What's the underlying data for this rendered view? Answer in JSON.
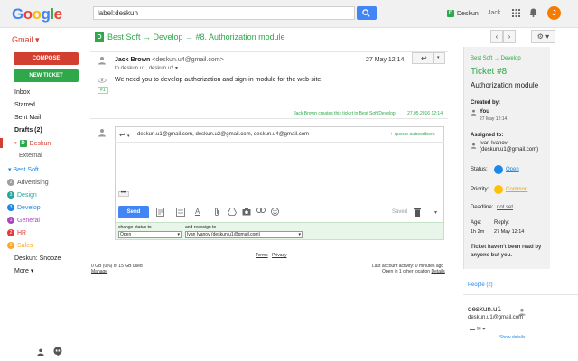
{
  "app": {
    "logo": "Google",
    "search_value": "label:deskun",
    "deskun_label": "Deskun",
    "user_name": "Jack",
    "avatar_letter": "J",
    "gmail_menu": "Gmail ▾"
  },
  "breadcrumb": {
    "icon": "D",
    "path": "Best Soft → Develop → #8. Authorization module"
  },
  "toolbar": {
    "prev": "‹",
    "next": "›",
    "settings": "⚙ ▾"
  },
  "sidebar": {
    "compose": "COMPOSE",
    "new_ticket": "NEW TICKET",
    "items": [
      {
        "label": "Inbox"
      },
      {
        "label": "Starred"
      },
      {
        "label": "Sent Mail"
      },
      {
        "label": "Drafts (2)"
      }
    ],
    "deskun": "Deskun",
    "external": "External",
    "best_soft": "▾ Best Soft",
    "labels": [
      {
        "num": "2",
        "label": "Advertising",
        "color": "#9e9e9e",
        "text_color": "#555"
      },
      {
        "num": "3",
        "label": "Design",
        "color": "#26a69a",
        "text_color": "#26a69a"
      },
      {
        "num": "3",
        "label": "Develop",
        "color": "#1e88e5",
        "text_color": "#1e88e5"
      },
      {
        "num": "1",
        "label": "General",
        "color": "#ab47bc",
        "text_color": "#ab47bc"
      },
      {
        "num": "2",
        "label": "HR",
        "color": "#e53935",
        "text_color": "#e53935"
      },
      {
        "num": "3",
        "label": "Sales",
        "color": "#ffa726",
        "text_color": "#ffa726"
      }
    ],
    "snooze": "Deskun: Snooze",
    "more": "More ▾"
  },
  "email": {
    "sender": "Jack Brown",
    "sender_email": "<deskun.u4@gmail.com>",
    "date": "27 May 12:14",
    "to": "to deskun.u1, deskun.u2 ▾",
    "body": "We need you to develop authorization and sign-in module for the web-site.",
    "ticket_badge": "#1",
    "log": "Jack Brown creates this ticket in Best Soft/Develop",
    "log_date": "27.05.2016 12:14"
  },
  "reply": {
    "recipients": "deskun.u1@gmail.com, deskun.u2@gmail.com, deskun.u4@gmail.com",
    "queue": "+ queue subscribers",
    "ellipsis": "•••",
    "send": "Send",
    "saved": "Saved",
    "change_status_label": "change status to",
    "status_value": "Open",
    "reassign_label": "and reassign to",
    "reassign_value": "Ivan Ivanov (deskun.u1@gmail.com)"
  },
  "footer": {
    "terms": "Terms",
    "privacy": "Privacy",
    "storage": "0 GB (0%) of 15 GB used",
    "manage": "Manage",
    "activity": "Last account activity: 0 minutes ago",
    "details_line": "Open in 1 other location",
    "details": "Details"
  },
  "ticket_panel": {
    "breadcrumb": "Best Soft → Develop",
    "ticket": "Ticket #8",
    "subject": "Authorization module",
    "created_by_label": "Created by:",
    "created_by": "You",
    "created_date": "27 May 12:14",
    "assigned_label": "Assigned to:",
    "assignee": "Ivan Ivanov",
    "assignee_email": "(deskun.u1@gmail.com)",
    "status_label": "Status:",
    "status": "Open",
    "priority_label": "Priority:",
    "priority": "Common",
    "deadline_label": "Deadline:",
    "deadline": "not set",
    "age_label": "Age:",
    "reply_label": "Reply:",
    "age": "1h 2m",
    "reply": "27 May 12:14",
    "note": "Ticket haven't been read by anyone but you."
  },
  "people": {
    "label": "People (2)",
    "name": "deskun.u1",
    "email": "deskun.u1@gmail.com",
    "actions": "▬ ✉ ▾",
    "show_details": "Show details"
  }
}
